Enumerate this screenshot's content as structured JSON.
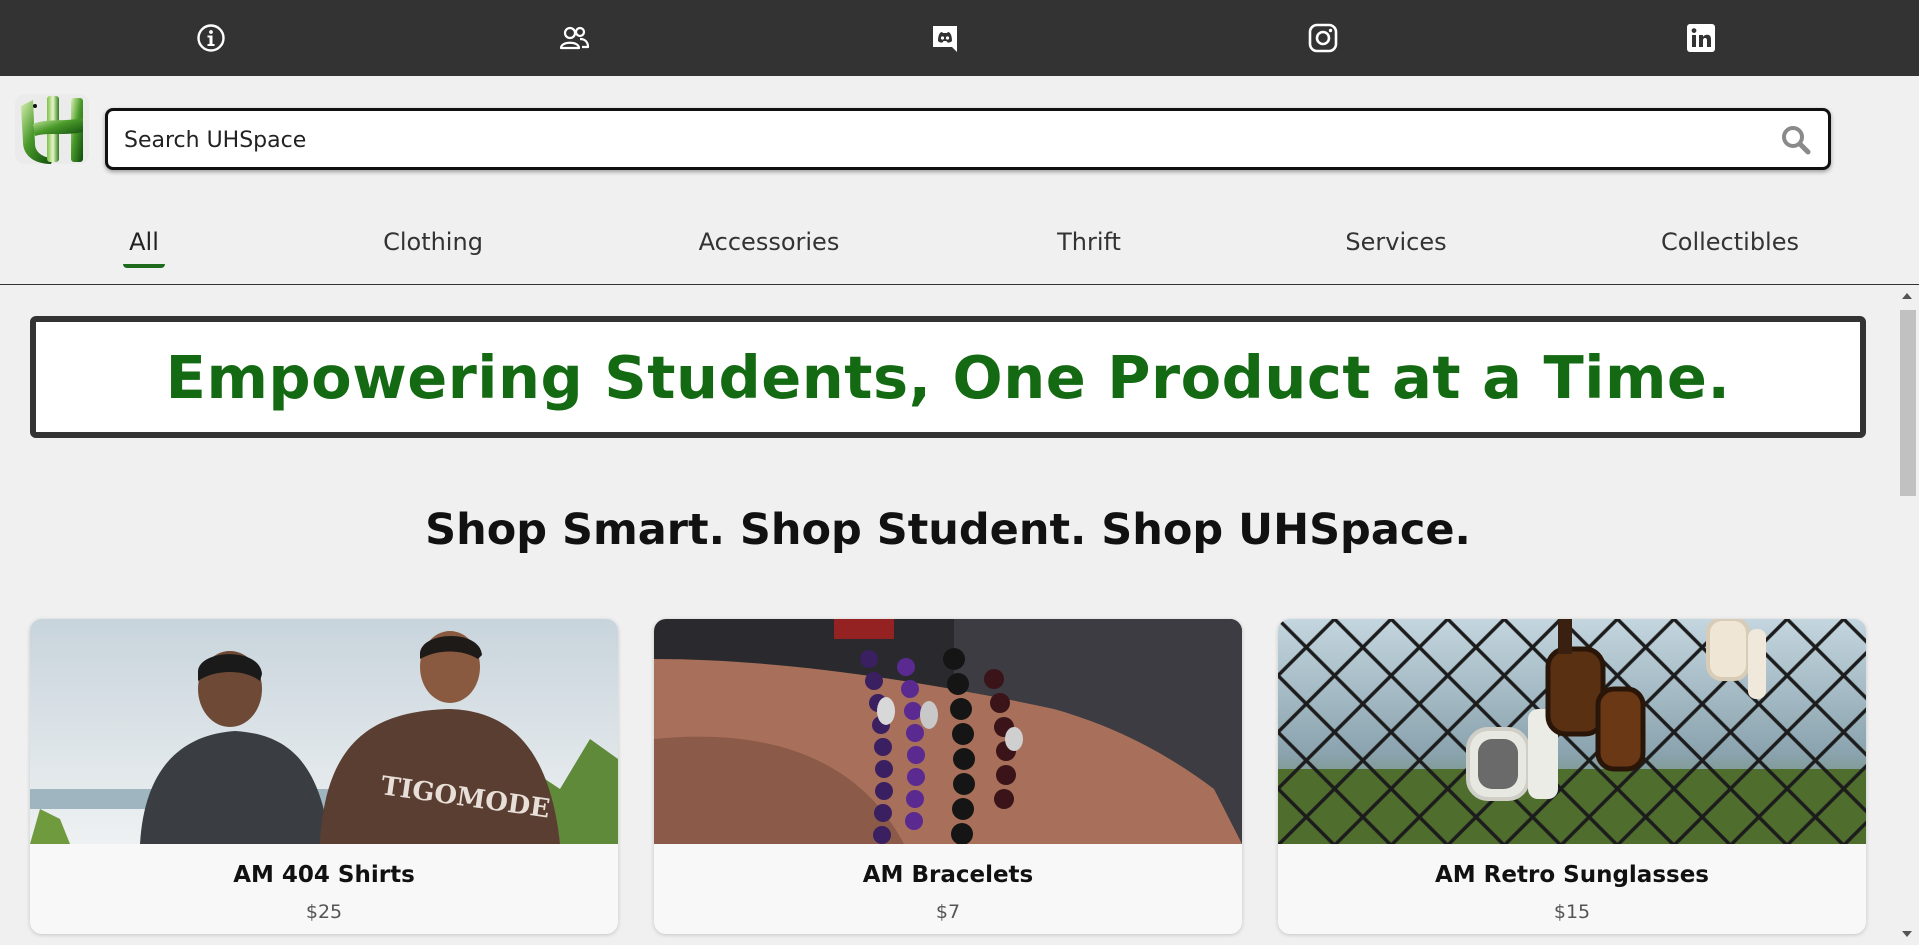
{
  "topbar": {
    "icons": [
      "info-icon",
      "users-icon",
      "discord-icon",
      "instagram-icon",
      "linkedin-icon"
    ]
  },
  "search": {
    "placeholder": "Search UHSpace"
  },
  "nav": {
    "items": [
      {
        "label": "All",
        "active": true
      },
      {
        "label": "Clothing"
      },
      {
        "label": "Accessories"
      },
      {
        "label": "Thrift"
      },
      {
        "label": "Services"
      },
      {
        "label": "Collectibles"
      }
    ]
  },
  "banner": {
    "text": "Empowering Students, One Product at a Time."
  },
  "tagline": "Shop Smart. Shop Student. Shop UHSpace.",
  "products": [
    {
      "title": "AM 404 Shirts",
      "price": "$25"
    },
    {
      "title": "AM Bracelets",
      "price": "$7"
    },
    {
      "title": "AM Retro Sunglasses",
      "price": "$15"
    }
  ],
  "colors": {
    "topbar": "#333333",
    "page_bg": "#f0f0f0",
    "brand_green": "#136a12",
    "nav_underline": "#1e6b1e"
  }
}
